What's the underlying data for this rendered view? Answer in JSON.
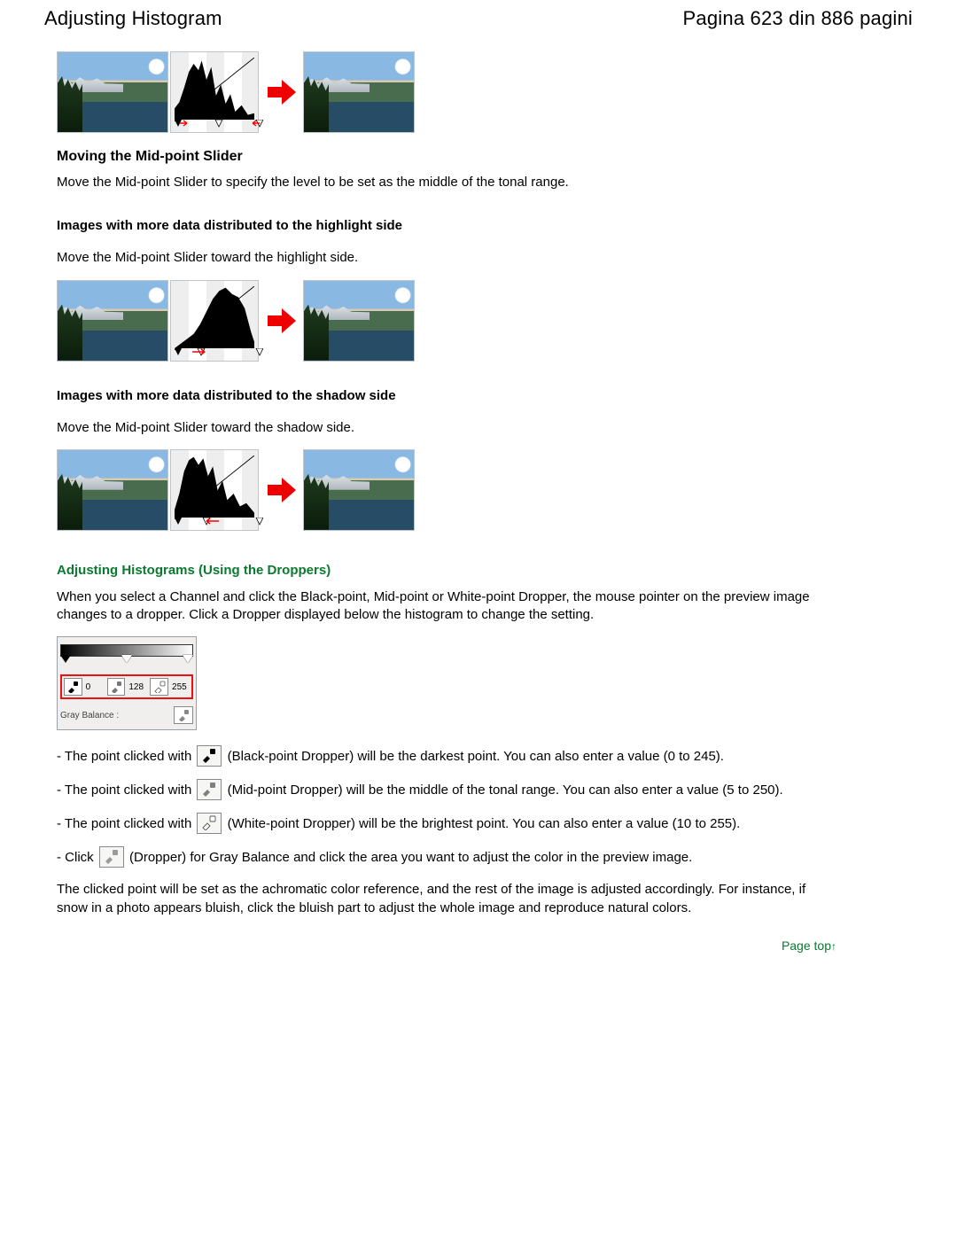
{
  "header": {
    "title": "Adjusting Histogram",
    "page_indicator": "Pagina 623 din 886 pagini"
  },
  "section_midpoint": {
    "heading": "Moving the Mid-point Slider",
    "intro": "Move the Mid-point Slider to specify the level to be set as the middle of the tonal range.",
    "highlight_heading": "Images with more data distributed to the highlight side",
    "highlight_text": "Move the Mid-point Slider toward the highlight side.",
    "shadow_heading": "Images with more data distributed to the shadow side",
    "shadow_text": "Move the Mid-point Slider toward the shadow side."
  },
  "section_droppers": {
    "heading": "Adjusting Histograms (Using the Droppers)",
    "intro": "When you select a Channel and click the Black-point, Mid-point or White-point Dropper, the mouse pointer on the preview image changes to a dropper. Click a Dropper displayed below the histogram to change the setting.",
    "panel": {
      "values": {
        "black": "0",
        "mid": "128",
        "white": "255"
      },
      "gray_label": "Gray Balance :"
    },
    "bullets": {
      "prefix": "- The point clicked with ",
      "black": " (Black-point Dropper) will be the darkest point. You can also enter a value (0 to 245).",
      "mid": " (Mid-point Dropper) will be the middle of the tonal range. You can also enter a value (5 to 250).",
      "white": " (White-point Dropper) will be the brightest point. You can also enter a value (10 to 255).",
      "click_prefix": "- Click ",
      "gray": " (Dropper) for Gray Balance and click the area you want to adjust the color in the preview image."
    },
    "closing": "The clicked point will be set as the achromatic color reference, and the rest of the image is adjusted accordingly. For instance, if snow in a photo appears bluish, click the bluish part to adjust the whole image and reproduce natural colors."
  },
  "footer": {
    "page_top": "Page top"
  }
}
